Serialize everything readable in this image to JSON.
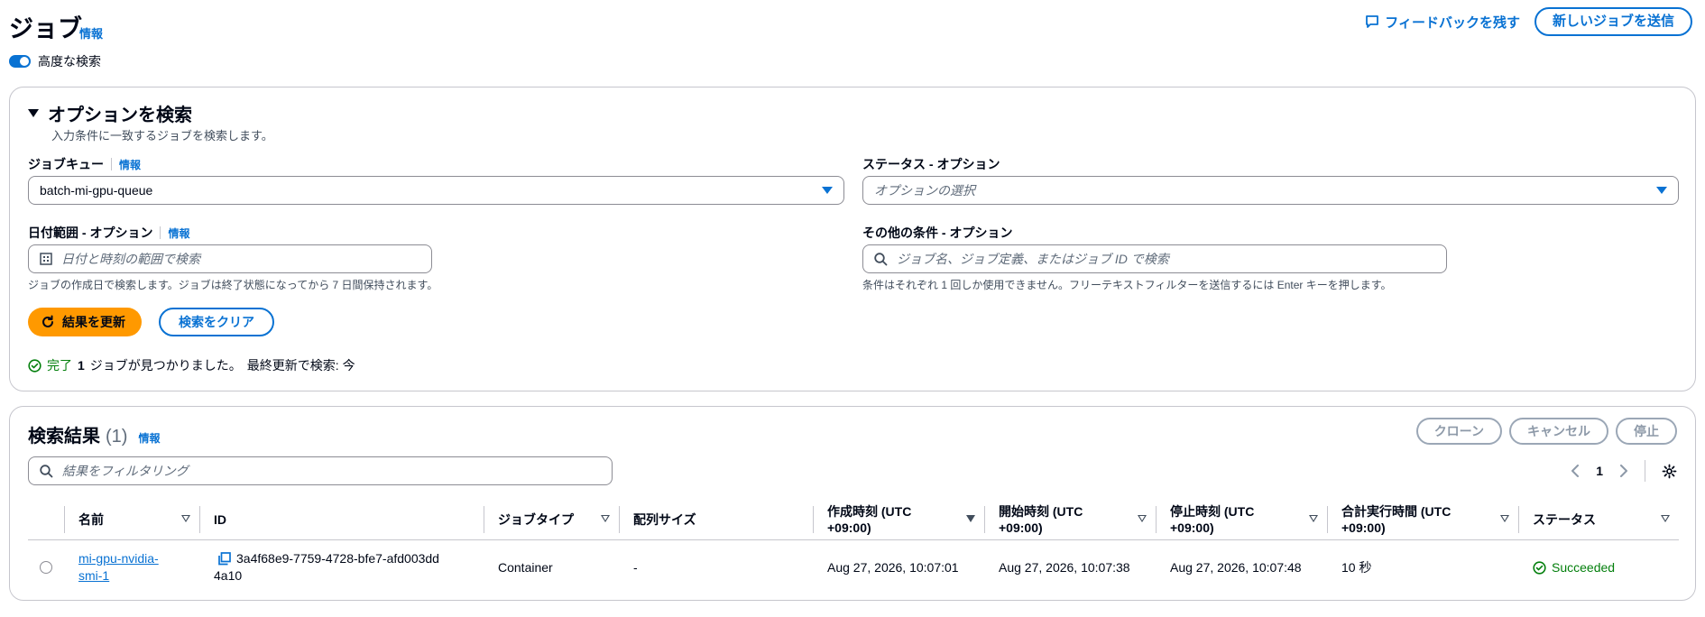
{
  "header": {
    "title": "ジョブ",
    "info": "情報",
    "feedback": "フィードバックを残す",
    "submit_button": "新しいジョブを送信"
  },
  "advanced_search": {
    "label": "高度な検索",
    "enabled": true
  },
  "search_panel": {
    "title": "オプションを検索",
    "description": "入力条件に一致するジョブを検索します。",
    "job_queue": {
      "label": "ジョブキュー",
      "info": "情報",
      "value": "batch-mi-gpu-queue"
    },
    "status": {
      "label": "ステータス - オプション",
      "placeholder": "オプションの選択"
    },
    "date_range": {
      "label": "日付範囲 - オプション",
      "info": "情報",
      "placeholder": "日付と時刻の範囲で検索",
      "hint": "ジョブの作成日で検索します。ジョブは終了状態になってから 7 日間保持されます。"
    },
    "other": {
      "label": "その他の条件 - オプション",
      "placeholder": "ジョブ名、ジョブ定義、またはジョブ ID で検索",
      "hint": "条件はそれぞれ 1 回しか使用できません。フリーテキストフィルターを送信するには Enter キーを押します。"
    },
    "refresh_button": "結果を更新",
    "clear_button": "検索をクリア",
    "status_line": {
      "state": "完了",
      "count": "1",
      "found": "ジョブが見つかりました。",
      "last_updated": "最終更新で検索: 今"
    }
  },
  "results": {
    "title": "検索結果",
    "count": "(1)",
    "info": "情報",
    "buttons": {
      "clone": "クローン",
      "cancel": "キャンセル",
      "stop": "停止"
    },
    "filter_placeholder": "結果をフィルタリング",
    "page": "1",
    "columns": {
      "name": "名前",
      "id": "ID",
      "job_type": "ジョブタイプ",
      "array_size": "配列サイズ",
      "created_a": "作成時刻 (UTC",
      "created_b": "+09:00)",
      "started_a": "開始時刻 (UTC",
      "started_b": "+09:00)",
      "stopped_a": "停止時刻 (UTC",
      "stopped_b": "+09:00)",
      "total_a": "合計実行時間 (UTC",
      "total_b": "+09:00)",
      "status": "ステータス"
    },
    "rows": [
      {
        "name_a": "mi-gpu-nvidia-",
        "name_b": "smi-1",
        "id_a": "3a4f68e9-7759-4728-bfe7-afd003dd",
        "id_b": "4a10",
        "job_type": "Container",
        "array_size": "-",
        "created": "Aug 27, 2026, 10:07:01",
        "started": "Aug 27, 2026, 10:07:38",
        "stopped": "Aug 27, 2026, 10:07:48",
        "total": "10 秒",
        "status": "Succeeded"
      }
    ]
  },
  "colors": {
    "link": "#0972d3",
    "primary": "#ff9900",
    "success": "#037f0c",
    "border": "#c6c6cd"
  }
}
